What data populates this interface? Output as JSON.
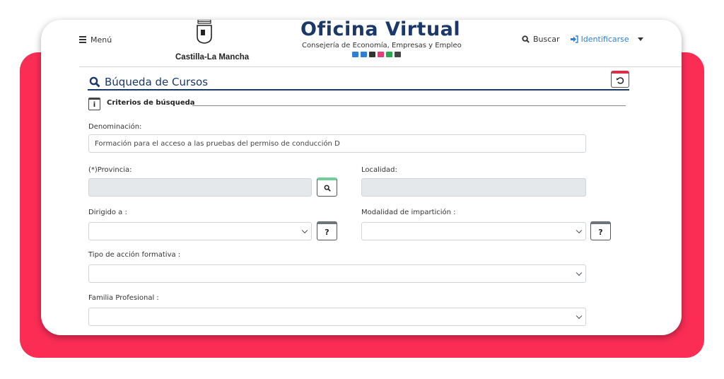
{
  "header": {
    "menu_label": "Menú",
    "brand_name": "Castilla-La Mancha",
    "portal_title": "Oficina Virtual",
    "portal_subtitle": "Consejería de Economía, Empresas y Empleo",
    "search_label": "Buscar",
    "login_label": "Identificarse",
    "portal_icon_colors": [
      "#2d7fd6",
      "#2d7fd6",
      "#333333",
      "#e0407a",
      "#2ea44f",
      "#444444"
    ]
  },
  "page": {
    "title": "Búqueda de Cursos",
    "section_title": "Criterios de búsqueda"
  },
  "form": {
    "denominacion": {
      "label": "Denominación:",
      "value": "Formación para el acceso a las pruebas del permiso de conducción D"
    },
    "provincia": {
      "label": "(*)Provincia:",
      "value": ""
    },
    "localidad": {
      "label": "Localidad:",
      "value": ""
    },
    "dirigido": {
      "label": "Dirigido a :",
      "value": "",
      "help": "?"
    },
    "modalidad": {
      "label": "Modalidad de impartición :",
      "value": "",
      "help": "?"
    },
    "tipo_accion": {
      "label": "Tipo de acción formativa :",
      "value": ""
    },
    "familia": {
      "label": "Familia Profesional :",
      "value": ""
    }
  },
  "colors": {
    "accent": "#fb2d55",
    "navy": "#1a3868",
    "link": "#2d7fd6"
  }
}
